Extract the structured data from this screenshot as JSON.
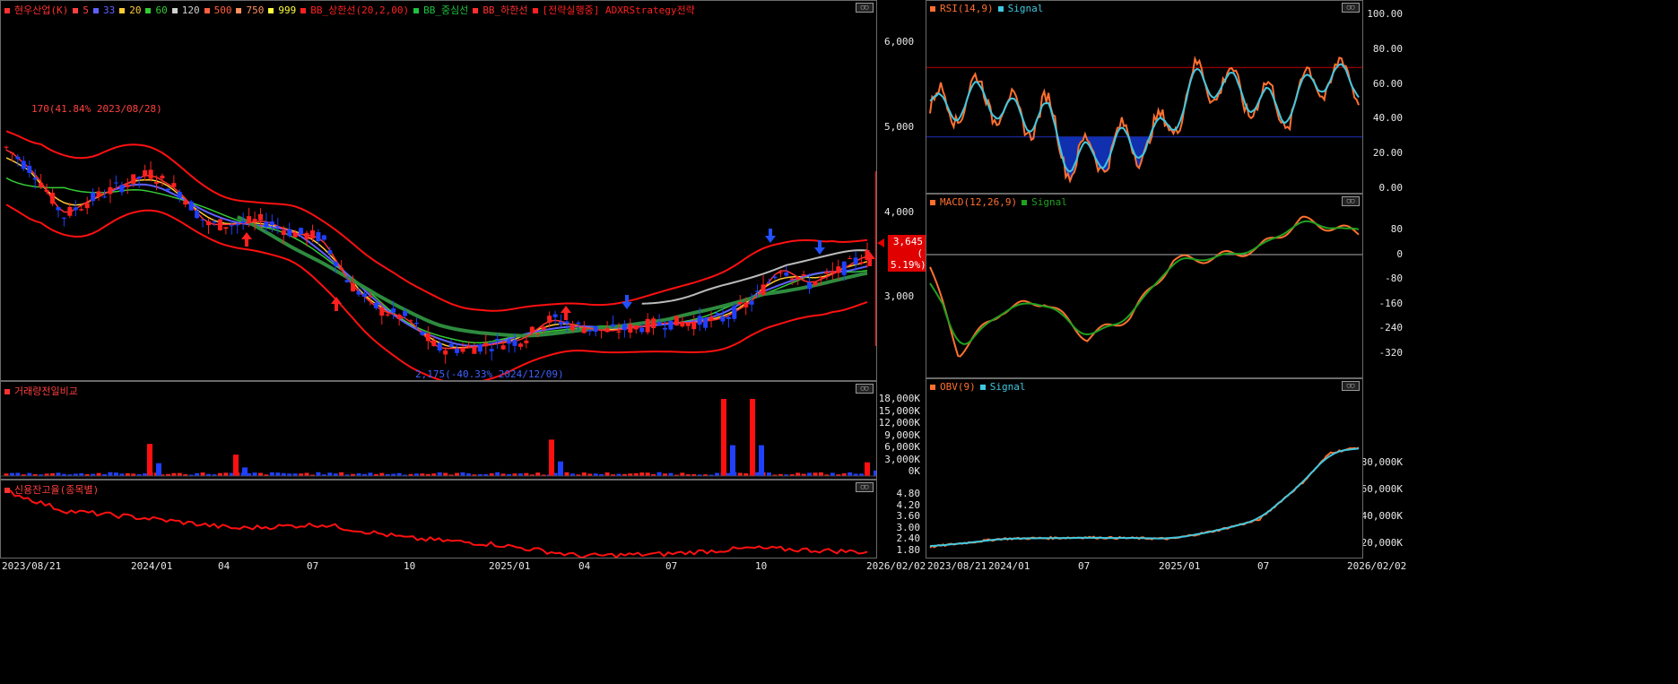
{
  "left_panels": {
    "main": {
      "legend": [
        {
          "label": "현우산업(K)",
          "color": "#ff3030"
        },
        {
          "label": "5",
          "color": "#ff4040"
        },
        {
          "label": "33",
          "color": "#6060ff"
        },
        {
          "label": "20",
          "color": "#ffcc33"
        },
        {
          "label": "60",
          "color": "#33cc33"
        },
        {
          "label": "120",
          "color": "#d0d0d0"
        },
        {
          "label": "500",
          "color": "#ff6040"
        },
        {
          "label": "750",
          "color": "#ff9060"
        },
        {
          "label": "999",
          "color": "#ffff40"
        },
        {
          "label": "BB_상한선(20,2,00)",
          "color": "#ff2020"
        },
        {
          "label": "BB_중심선",
          "color": "#20c040"
        },
        {
          "label": "BB_하한선",
          "color": "#ff3030"
        },
        {
          "label": "[전략실행중] ADXRStrategy전략",
          "color": "#ff2020"
        }
      ],
      "y_ticks": [
        "6,000",
        "5,000",
        "4,000",
        "3,000"
      ],
      "high_note": "170(41.84% 2023/08/28)",
      "low_note": "2,175(-40.33% 2024/12/09)",
      "price_tag": {
        "value": "3,645",
        "change": "( 5.19%)"
      }
    },
    "volume": {
      "legend_label": "거래량전일비교",
      "y_ticks": [
        "18,000K",
        "15,000K",
        "12,000K",
        "9,000K",
        "6,000K",
        "3,000K",
        "0K"
      ]
    },
    "credit": {
      "legend_label": "신용잔고율(종목별)",
      "y_ticks": [
        "4.80",
        "4.20",
        "3.60",
        "3.00",
        "2.40",
        "1.80"
      ]
    },
    "x_ticks": [
      "2023/08/21",
      "2024/01",
      "04",
      "07",
      "10",
      "2025/01",
      "04",
      "07",
      "10",
      "2026/02/02"
    ]
  },
  "right_panels": {
    "rsi": {
      "legend": [
        {
          "label": "RSI(14,9)",
          "color": "#ff7030"
        },
        {
          "label": "Signal",
          "color": "#40c8e0"
        }
      ],
      "y_ticks": [
        "100.00",
        "80.00",
        "60.00",
        "40.00",
        "20.00",
        "0.00"
      ]
    },
    "macd": {
      "legend": [
        {
          "label": "MACD(12,26,9)",
          "color": "#ff7030"
        },
        {
          "label": "Signal",
          "color": "#20a020"
        }
      ],
      "y_ticks": [
        "80",
        "0",
        "-80",
        "-160",
        "-240",
        "-320"
      ]
    },
    "obv": {
      "legend": [
        {
          "label": "OBV(9)",
          "color": "#ff7030"
        },
        {
          "label": "Signal",
          "color": "#40c8e0"
        }
      ],
      "y_ticks": [
        "80,000K",
        "60,000K",
        "40,000K",
        "20,000K"
      ]
    },
    "x_ticks": [
      "2023/08/21",
      "2024/01",
      "07",
      "2025/01",
      "07",
      "2026/02/02"
    ]
  },
  "chart_data": {
    "type": "candlestick",
    "price_axis_range": [
      2175,
      6500
    ],
    "last_price": 3645,
    "last_change_pct": 5.19,
    "high": {
      "value": 170,
      "pct": 41.84,
      "date": "2023/08/28"
    },
    "low": {
      "value": 2175,
      "pct": -40.33,
      "date": "2024/12/09"
    },
    "close_path": [
      {
        "x": "2023/08",
        "y": 4900
      },
      {
        "x": "2023/09",
        "y": 4600
      },
      {
        "x": "2023/10",
        "y": 4100
      },
      {
        "x": "2023/11",
        "y": 4300
      },
      {
        "x": "2023/12",
        "y": 4450
      },
      {
        "x": "2024/01",
        "y": 4600
      },
      {
        "x": "2024/02",
        "y": 4400
      },
      {
        "x": "2024/03",
        "y": 4000
      },
      {
        "x": "2024/04",
        "y": 4000
      },
      {
        "x": "2024/05",
        "y": 4050
      },
      {
        "x": "2024/06",
        "y": 3900
      },
      {
        "x": "2024/07",
        "y": 3850
      },
      {
        "x": "2024/08",
        "y": 3300
      },
      {
        "x": "2024/09",
        "y": 3000
      },
      {
        "x": "2024/10",
        "y": 2900
      },
      {
        "x": "2024/11",
        "y": 2550
      },
      {
        "x": "2024/12",
        "y": 2550
      },
      {
        "x": "2025/01",
        "y": 2600
      },
      {
        "x": "2025/02",
        "y": 2650
      },
      {
        "x": "2025/03",
        "y": 2900
      },
      {
        "x": "2025/04",
        "y": 2800
      },
      {
        "x": "2025/05",
        "y": 2750
      },
      {
        "x": "2025/06",
        "y": 2800
      },
      {
        "x": "2025/07",
        "y": 2850
      },
      {
        "x": "2025/08",
        "y": 2850
      },
      {
        "x": "2025/09",
        "y": 2900
      },
      {
        "x": "2025/10",
        "y": 3100
      },
      {
        "x": "2025/11",
        "y": 3500
      },
      {
        "x": "2025/12",
        "y": 3300
      },
      {
        "x": "2026/01",
        "y": 3450
      },
      {
        "x": "2026/02",
        "y": 3645
      }
    ],
    "volume_spikes_k": [
      {
        "x": "2024/01",
        "v": 7500
      },
      {
        "x": "2024/04",
        "v": 5000
      },
      {
        "x": "2025/03",
        "v": 8500
      },
      {
        "x": "2025/09",
        "v": 18000
      },
      {
        "x": "2025/10",
        "v": 18000
      },
      {
        "x": "2026/02",
        "v": 3200
      }
    ],
    "credit_ratio": [
      {
        "x": "2023/08",
        "y": 5.0
      },
      {
        "x": "2023/10",
        "y": 4.0
      },
      {
        "x": "2024/01",
        "y": 3.6
      },
      {
        "x": "2024/04",
        "y": 3.1
      },
      {
        "x": "2024/07",
        "y": 3.3
      },
      {
        "x": "2024/10",
        "y": 2.6
      },
      {
        "x": "2025/01",
        "y": 2.3
      },
      {
        "x": "2025/04",
        "y": 1.7
      },
      {
        "x": "2025/07",
        "y": 1.8
      },
      {
        "x": "2025/10",
        "y": 2.1
      },
      {
        "x": "2026/02",
        "y": 1.9
      }
    ],
    "rsi": [
      {
        "x": "2023/08",
        "y": 45
      },
      {
        "x": "2023/12",
        "y": 55
      },
      {
        "x": "2024/02",
        "y": 40
      },
      {
        "x": "2024/04",
        "y": 45
      },
      {
        "x": "2024/06",
        "y": 15
      },
      {
        "x": "2024/09",
        "y": 25
      },
      {
        "x": "2024/12",
        "y": 30
      },
      {
        "x": "2025/03",
        "y": 65
      },
      {
        "x": "2025/06",
        "y": 55
      },
      {
        "x": "2025/09",
        "y": 45
      },
      {
        "x": "2025/11",
        "y": 65
      },
      {
        "x": "2026/02",
        "y": 62
      }
    ],
    "rsi_levels": [
      70,
      30
    ],
    "macd": [
      {
        "x": "2023/08",
        "y": -40
      },
      {
        "x": "2023/10",
        "y": -320
      },
      {
        "x": "2024/01",
        "y": -180
      },
      {
        "x": "2024/04",
        "y": -150
      },
      {
        "x": "2024/07",
        "y": -270
      },
      {
        "x": "2024/10",
        "y": -200
      },
      {
        "x": "2025/01",
        "y": -20
      },
      {
        "x": "2025/04",
        "y": -10
      },
      {
        "x": "2025/07",
        "y": 20
      },
      {
        "x": "2025/10",
        "y": 110
      },
      {
        "x": "2026/02",
        "y": 70
      }
    ],
    "obv_k": [
      {
        "x": "2023/08",
        "y": 18000
      },
      {
        "x": "2024/01",
        "y": 24000
      },
      {
        "x": "2024/07",
        "y": 25000
      },
      {
        "x": "2025/01",
        "y": 24000
      },
      {
        "x": "2025/04",
        "y": 30000
      },
      {
        "x": "2025/07",
        "y": 38000
      },
      {
        "x": "2025/10",
        "y": 65000
      },
      {
        "x": "2025/12",
        "y": 88000
      },
      {
        "x": "2026/02",
        "y": 92000
      }
    ]
  }
}
